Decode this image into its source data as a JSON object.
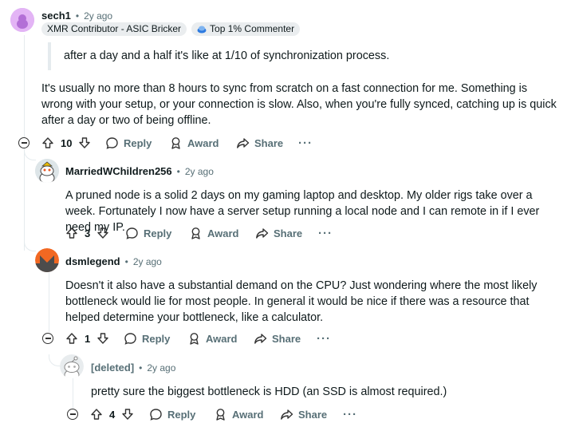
{
  "comments": [
    {
      "username": "sech1",
      "time": "2y ago",
      "flairs": [
        "XMR Contributor - ASIC Bricker",
        "Top 1% Commenter"
      ],
      "quote": "after a day and a half it's like at 1/10 of synchronization process.",
      "body": "It's usually no more than 8 hours to sync from scratch on a fast connection for me. Something is wrong with your setup, or your connection is slow. Also, when you're fully synced, catching up is quick after a day or two of being offline.",
      "votes": "10"
    },
    {
      "username": "MarriedWChildren256",
      "time": "2y ago",
      "body": "A pruned node is a solid 2 days on my gaming laptop and desktop. My older rigs take over a week. Fortunately I now have a server setup running a local node and I can remote in if I ever need my IP.",
      "votes": "3"
    },
    {
      "username": "dsmlegend",
      "time": "2y ago",
      "body": "Doesn't it also have a substantial demand on the CPU? Just wondering where the most likely bottleneck would lie for most people. In general it would be nice if there was a resource that helped determine your bottleneck, like a calculator.",
      "votes": "1"
    },
    {
      "username": "[deleted]",
      "time": "2y ago",
      "body": "pretty sure the biggest bottleneck is HDD (an SSD is almost required.)",
      "votes": "4"
    }
  ],
  "actions": {
    "reply": "Reply",
    "award": "Award",
    "share": "Share",
    "more": "···"
  },
  "colors": {
    "text": "#0f1a1c",
    "muted": "#576f76",
    "flair_bg": "#eaedef",
    "monero_orange": "#f26822"
  }
}
